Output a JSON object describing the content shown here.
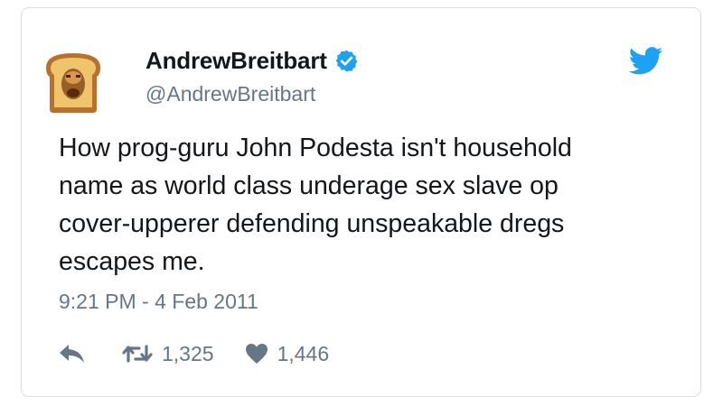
{
  "tweet": {
    "display_name": "AndrewBreitbart",
    "handle": "@AndrewBreitbart",
    "text_lines": [
      "How prog-guru John Podesta isn't household",
      "name as world class underage sex slave op",
      "cover-upperer defending unspeakable dregs",
      "escapes me."
    ],
    "timestamp": "9:21 PM - 4 Feb 2011",
    "retweet_count": "1,325",
    "like_count": "1,446"
  },
  "icons": {
    "avatar": "toast-face-avatar",
    "verified": "verified-badge-icon",
    "brand": "twitter-bird-icon",
    "reply": "reply-arrow-icon",
    "retweet": "retweet-icon",
    "like": "heart-icon"
  },
  "colors": {
    "text": "#14171a",
    "secondary": "#657786",
    "brand": "#1da1f2",
    "border": "#d9dee2"
  }
}
